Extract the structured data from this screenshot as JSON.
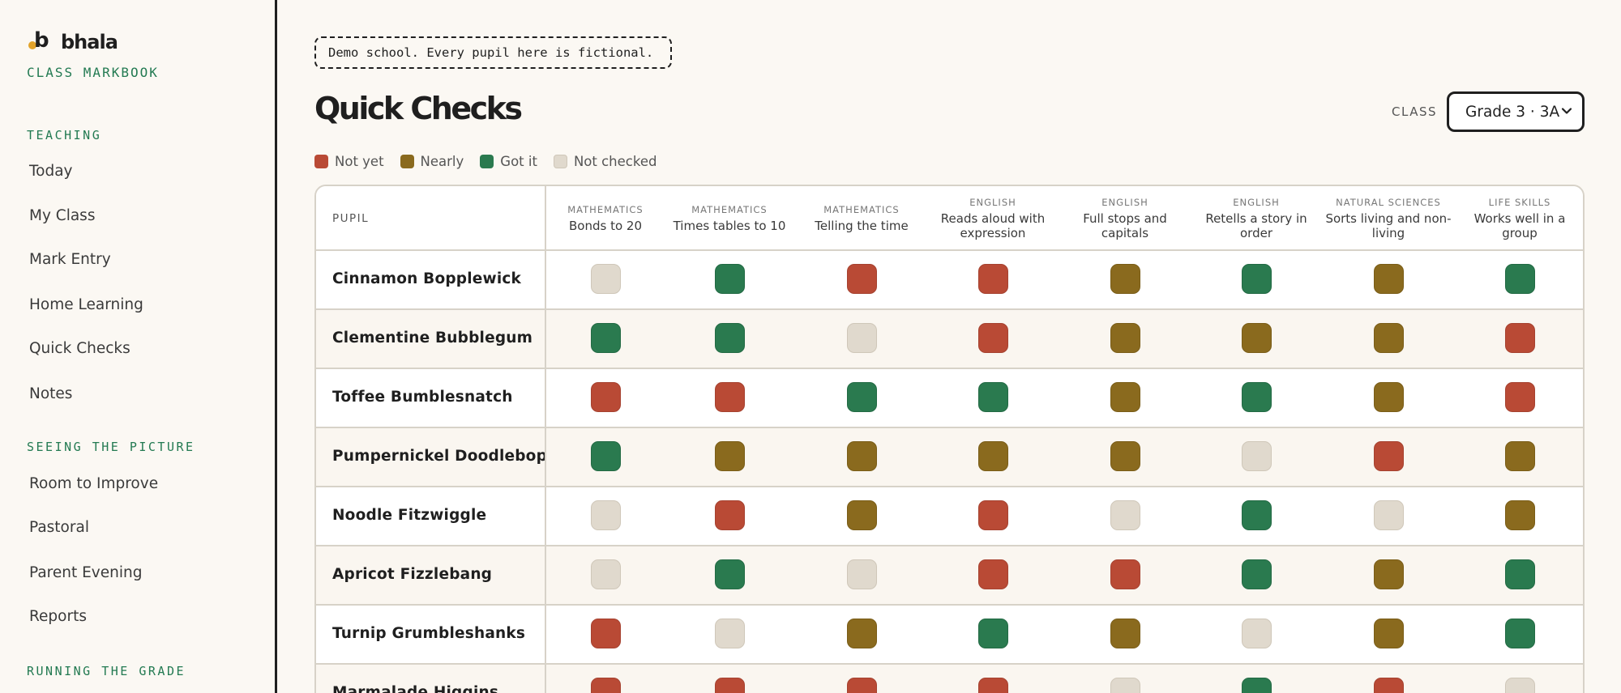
{
  "sidebar": {
    "brand_name": "bhala",
    "brand_sub": "CLASS MARKBOOK",
    "sections": [
      {
        "title": "TEACHING",
        "items": [
          "Today",
          "My Class",
          "Mark Entry",
          "Home Learning",
          "Quick Checks",
          "Notes"
        ]
      },
      {
        "title": "SEEING THE PICTURE",
        "items": [
          "Room to Improve",
          "Pastoral",
          "Parent Evening",
          "Reports"
        ]
      },
      {
        "title": "RUNNING THE GRADE",
        "items": []
      }
    ]
  },
  "main": {
    "demo_banner": "Demo school. Every pupil here is fictional.",
    "page_title": "Quick Checks",
    "class_label": "CLASS",
    "class_value": "Grade 3 · 3A"
  },
  "legend": [
    {
      "label": "Not yet",
      "status": "not-yet",
      "color": "#b94a35"
    },
    {
      "label": "Nearly",
      "status": "nearly",
      "color": "#8a6a1e"
    },
    {
      "label": "Got it",
      "status": "got-it",
      "color": "#2a7a4f"
    },
    {
      "label": "Not checked",
      "status": "not-checked",
      "color": "#e0d9cd"
    }
  ],
  "table": {
    "pupil_header": "PUPIL",
    "columns": [
      {
        "subject": "MATHEMATICS",
        "title": "Bonds to 20"
      },
      {
        "subject": "MATHEMATICS",
        "title": "Times tables to 10"
      },
      {
        "subject": "MATHEMATICS",
        "title": "Telling the time"
      },
      {
        "subject": "ENGLISH",
        "title": "Reads aloud with expression"
      },
      {
        "subject": "ENGLISH",
        "title": "Full stops and capitals"
      },
      {
        "subject": "ENGLISH",
        "title": "Retells a story in order"
      },
      {
        "subject": "NATURAL SCIENCES",
        "title": "Sorts living and non-living"
      },
      {
        "subject": "LIFE SKILLS",
        "title": "Works well in a group"
      }
    ],
    "rows": [
      {
        "name": "Cinnamon Bopplewick",
        "marks": [
          "not-checked",
          "got-it",
          "not-yet",
          "not-yet",
          "nearly",
          "got-it",
          "nearly",
          "got-it"
        ]
      },
      {
        "name": "Clementine Bubblegum",
        "marks": [
          "got-it",
          "got-it",
          "not-checked",
          "not-yet",
          "nearly",
          "nearly",
          "nearly",
          "not-yet"
        ]
      },
      {
        "name": "Toffee Bumblesnatch",
        "marks": [
          "not-yet",
          "not-yet",
          "got-it",
          "got-it",
          "nearly",
          "got-it",
          "nearly",
          "not-yet"
        ]
      },
      {
        "name": "Pumpernickel Doodlebop",
        "marks": [
          "got-it",
          "nearly",
          "nearly",
          "nearly",
          "nearly",
          "not-checked",
          "not-yet",
          "nearly"
        ]
      },
      {
        "name": "Noodle Fitzwiggle",
        "marks": [
          "not-checked",
          "not-yet",
          "nearly",
          "not-yet",
          "not-checked",
          "got-it",
          "not-checked",
          "nearly"
        ]
      },
      {
        "name": "Apricot Fizzlebang",
        "marks": [
          "not-checked",
          "got-it",
          "not-checked",
          "not-yet",
          "not-yet",
          "got-it",
          "nearly",
          "got-it"
        ]
      },
      {
        "name": "Turnip Grumbleshanks",
        "marks": [
          "not-yet",
          "not-checked",
          "nearly",
          "got-it",
          "nearly",
          "not-checked",
          "nearly",
          "got-it"
        ]
      },
      {
        "name": "Marmalade Higgins",
        "marks": [
          "not-yet",
          "not-yet",
          "not-yet",
          "not-yet",
          "not-checked",
          "got-it",
          "not-yet",
          "not-checked"
        ]
      }
    ]
  }
}
